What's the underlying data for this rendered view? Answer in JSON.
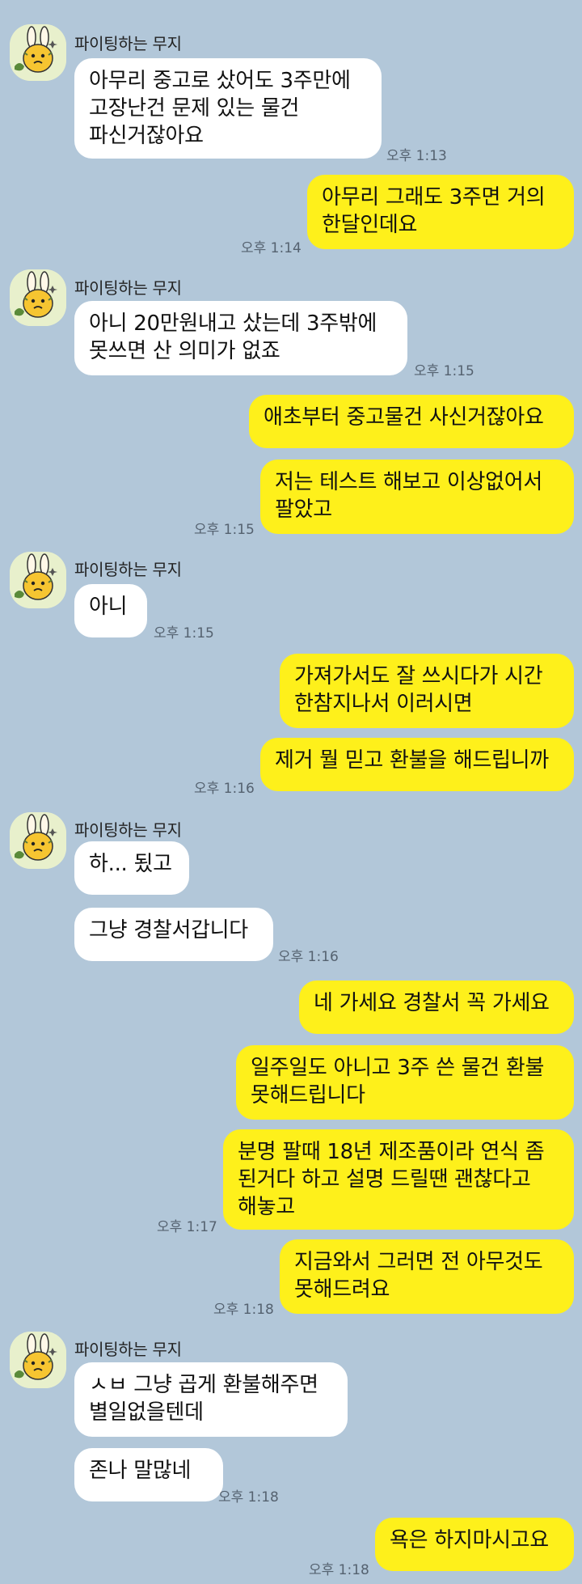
{
  "sender_name": "파이팅하는 무지",
  "messages": [
    {
      "text": "아무리 중고로 샀어도 3주만에\n고장난건 문제 있는 물건\n파신거잖아요",
      "time": "오후 1:13"
    },
    {
      "text": "아무리 그래도 3주면 거의\n한달인데요",
      "time": "오후 1:14"
    },
    {
      "text": "아니 20만원내고 샀는데 3주밖에\n못쓰면 산 의미가 없죠",
      "time": "오후 1:15"
    },
    {
      "text": "애초부터 중고물건 사신거잖아요",
      "time": ""
    },
    {
      "text": "저는 테스트 해보고 이상없어서\n팔았고",
      "time": "오후 1:15"
    },
    {
      "text": "아니",
      "time": "오후 1:15"
    },
    {
      "text": "가져가서도 잘 쓰시다가 시간\n한참지나서 이러시면",
      "time": ""
    },
    {
      "text": "제거 뭘 믿고 환불을 해드립니까",
      "time": "오후 1:16"
    },
    {
      "text": "하... 됬고",
      "time": ""
    },
    {
      "text": "그냥 경찰서갑니다",
      "time": "오후 1:16"
    },
    {
      "text": "네 가세요 경찰서 꼭 가세요",
      "time": ""
    },
    {
      "text": "일주일도 아니고 3주 쓴 물건 환불\n못해드립니다",
      "time": ""
    },
    {
      "text": "분명 팔때 18년 제조품이라 연식 좀\n된거다 하고 설명 드릴땐 괜찮다고\n해놓고",
      "time": "오후 1:17"
    },
    {
      "text": "지금와서 그러면 전 아무것도\n못해드려요",
      "time": "오후 1:18"
    },
    {
      "text": "ㅅㅂ 그냥 곱게 환불해주면\n별일없을텐데",
      "time": ""
    },
    {
      "text": "존나 말많네",
      "time": "오후 1:18"
    },
    {
      "text": "욕은 하지마시고요",
      "time": "오후 1:18"
    }
  ],
  "colors": {
    "background": "#b2c7d9",
    "incoming_bubble": "#ffffff",
    "outgoing_bubble": "#fef01b"
  },
  "icons": {
    "avatar": "muzi-character-avatar"
  }
}
